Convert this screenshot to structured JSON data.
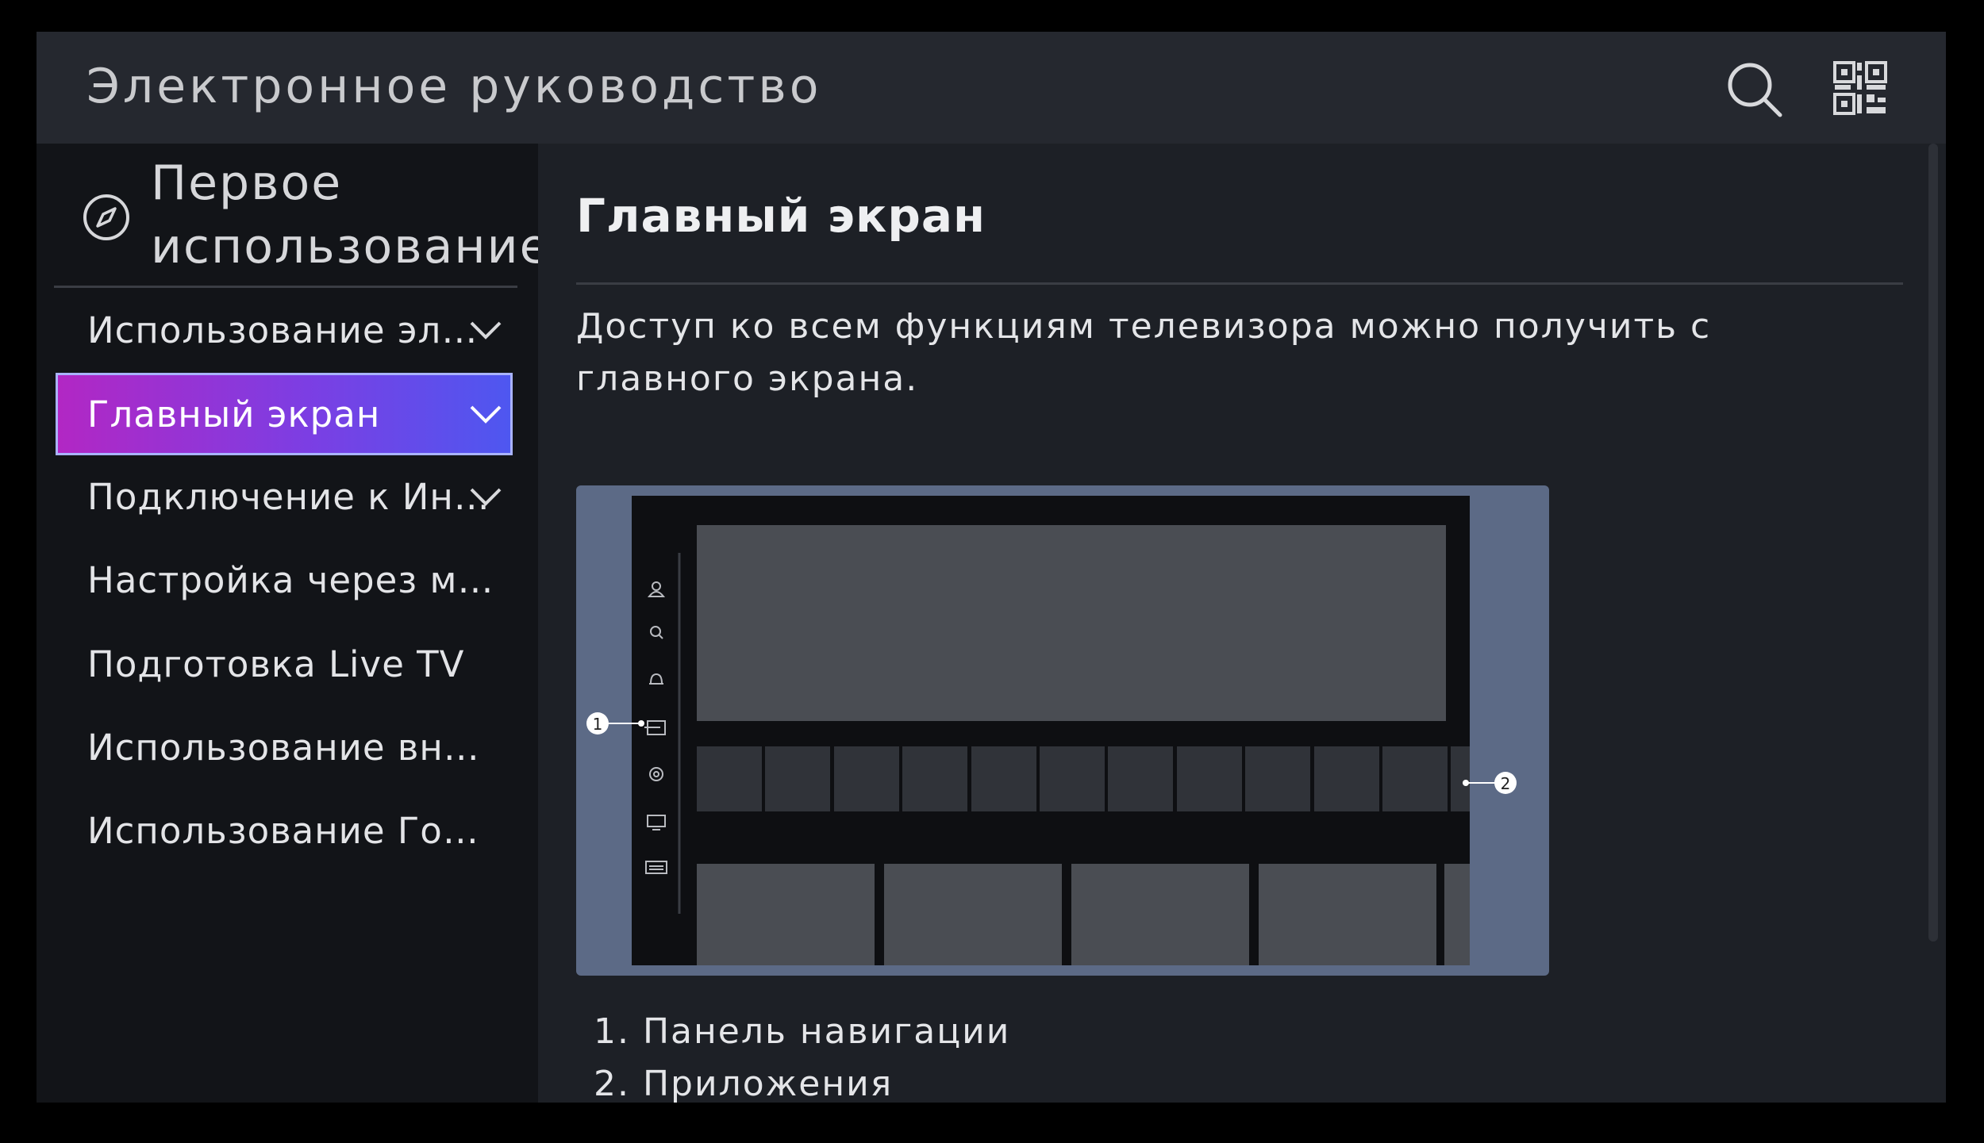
{
  "header": {
    "title": "Электронное руководство",
    "search_icon": "search-icon",
    "qr_icon": "qr-code-icon"
  },
  "sidebar": {
    "section_icon": "compass-icon",
    "section_title_line1": "Первое",
    "section_title_line2": "использование",
    "items": [
      {
        "label": "Использование эл…",
        "expandable": true,
        "active": false
      },
      {
        "label": "Главный экран",
        "expandable": true,
        "active": true
      },
      {
        "label": "Подключение к Ин…",
        "expandable": true,
        "active": false
      },
      {
        "label": "Настройка через м…",
        "expandable": false,
        "active": false
      },
      {
        "label": "Подготовка Live TV",
        "expandable": false,
        "active": false
      },
      {
        "label": "Использование вн…",
        "expandable": false,
        "active": false
      },
      {
        "label": "Использование Го…",
        "expandable": false,
        "active": false
      }
    ]
  },
  "content": {
    "title": "Главный экран",
    "intro": "Доступ ко всем функциям телевизора можно получить с главного экрана.",
    "illustration": {
      "callout_1": "1",
      "callout_2": "2",
      "nav_icons": [
        "profile-icon",
        "search-icon",
        "bell-icon",
        "input-icon",
        "settings-icon",
        "tv-icon",
        "keyboard-icon"
      ]
    },
    "legend": [
      "1. Панель навигации",
      "2. Приложения"
    ]
  },
  "colors": {
    "background": "#1b1e25",
    "header": "#25282f",
    "sidebar": "#121418",
    "active_gradient_start": "#b227c4",
    "active_gradient_end": "#4e57f0",
    "illustration_frame": "#5c6a86"
  }
}
